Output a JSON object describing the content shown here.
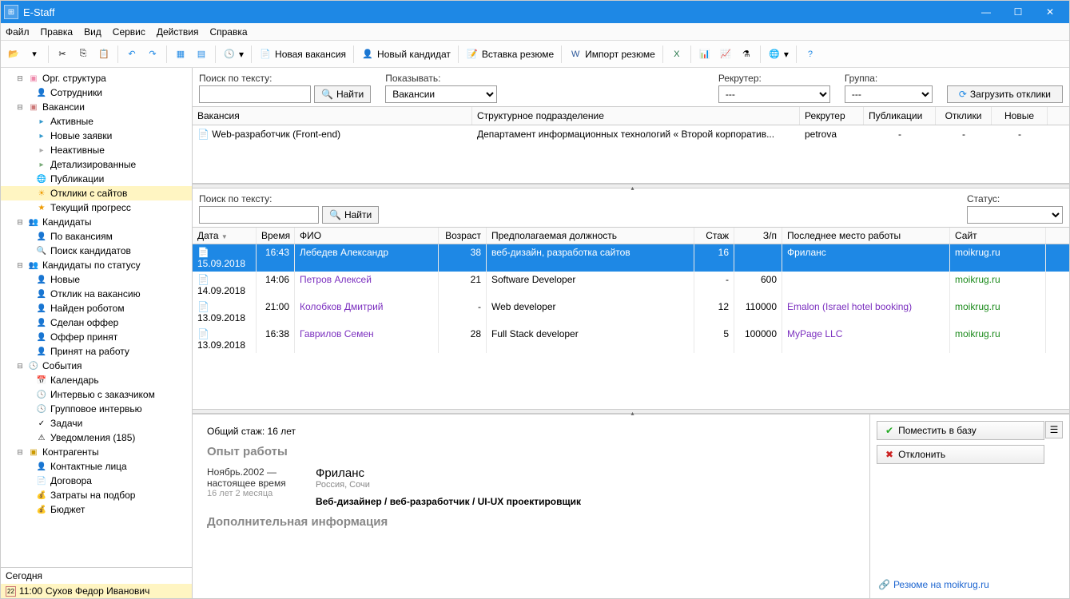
{
  "title": "E-Staff",
  "menu": [
    "Файл",
    "Правка",
    "Вид",
    "Сервис",
    "Действия",
    "Справка"
  ],
  "toolbar": {
    "new_vacancy": "Новая вакансия",
    "new_candidate": "Новый кандидат",
    "insert_resume": "Вставка резюме",
    "import_resume": "Импорт резюме"
  },
  "tree": {
    "org": "Орг. структура",
    "employees": "Сотрудники",
    "vacancies": "Вакансии",
    "vac_items": [
      "Активные",
      "Новые заявки",
      "Неактивные",
      "Детализированные",
      "Публикации",
      "Отклики с сайтов",
      "Текущий прогресс"
    ],
    "candidates": "Кандидаты",
    "cand_items": [
      "По вакансиям",
      "Поиск кандидатов"
    ],
    "cand_status": "Кандидаты по статусу",
    "cs_items": [
      "Новые",
      "Отклик на вакансию",
      "Найден роботом",
      "Сделан оффер",
      "Оффер принят",
      "Принят на работу"
    ],
    "events": "События",
    "ev_items": [
      "Календарь",
      "Интервью с заказчиком",
      "Групповое интервью",
      "Задачи",
      "Уведомления  (185)"
    ],
    "contr": "Контрагенты",
    "co_items": [
      "Контактные лица",
      "Договора",
      "Затраты на подбор",
      "Бюджет"
    ]
  },
  "agenda": {
    "today": "Сегодня",
    "time": "11:00",
    "person": "Сухов Федор Иванович"
  },
  "filter": {
    "search_label": "Поиск по тексту:",
    "find": "Найти",
    "show_label": "Показывать:",
    "show_value": "Вакансии",
    "recruiter_label": "Рекрутер:",
    "recruiter_value": "---",
    "group_label": "Группа:",
    "group_value": "---",
    "load": "Загрузить отклики",
    "status_label": "Статус:"
  },
  "vac_cols": [
    "Вакансия",
    "Структурное подразделение",
    "Рекрутер",
    "Публикации",
    "Отклики",
    "Новые"
  ],
  "vac_row": {
    "name": "Web-разработчик (Front-end)",
    "dept": "Департамент информационных технологий  «  Второй корпоратив...",
    "recruiter": "petrova",
    "pub": "-",
    "resp": "-",
    "new": "-"
  },
  "cand_cols": [
    "Дата",
    "Время",
    "ФИО",
    "Возраст",
    "Предполагаемая должность",
    "Стаж",
    "З/п",
    "Последнее место работы",
    "Сайт"
  ],
  "cand_rows": [
    {
      "date": "15.09.2018",
      "time": "16:43",
      "fio": "Лебедев Александр",
      "age": "38",
      "pos": "веб-дизайн, разработка сайтов",
      "exp": "16",
      "sal": "",
      "last": "Фриланс",
      "site": "moikrug.ru",
      "sel": true
    },
    {
      "date": "14.09.2018",
      "time": "14:06",
      "fio": "Петров Алексей",
      "age": "21",
      "pos": "Software Developer",
      "exp": "-",
      "sal": "600",
      "last": "",
      "site": "moikrug.ru"
    },
    {
      "date": "13.09.2018",
      "time": "21:00",
      "fio": "Колобков Дмитрий",
      "age": "-",
      "pos": "Web developer",
      "exp": "12",
      "sal": "110000",
      "last": "Emalon (Israel hotel booking)",
      "site": "moikrug.ru"
    },
    {
      "date": "13.09.2018",
      "time": "16:38",
      "fio": "Гаврилов Семен",
      "age": "28",
      "pos": "Full Stack developer",
      "exp": "5",
      "sal": "100000",
      "last": "MyPage LLC",
      "site": "moikrug.ru"
    }
  ],
  "resume": {
    "total_exp": "Общий стаж: 16 лет",
    "exp_hdr": "Опыт работы",
    "period": "Ноябрь.2002 — настоящее время",
    "duration": "16 лет 2 месяца",
    "company": "Фриланс",
    "location": "Россия, Сочи",
    "position": "Веб-дизайнер / веб-разработчик / UI-UX проектировщик",
    "extra_hdr": "Дополнительная информация"
  },
  "actions": {
    "add": "Поместить в базу",
    "reject": "Отклонить",
    "link": "Резюме на moikrug.ru"
  }
}
